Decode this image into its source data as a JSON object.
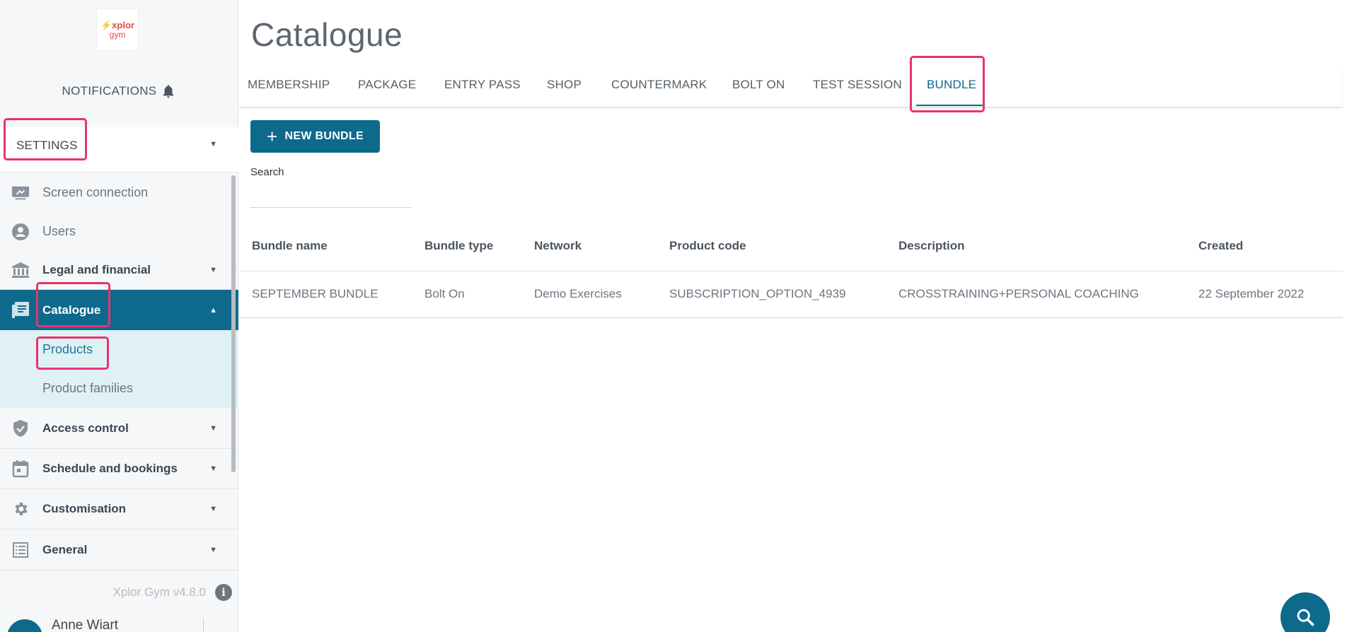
{
  "sidebar": {
    "logo": {
      "line1": "⚡xplor",
      "line2": "gym"
    },
    "notifications_label": "NOTIFICATIONS",
    "settings_label": "SETTINGS",
    "items": [
      {
        "label": "Screen connection",
        "icon": "screen-icon"
      },
      {
        "label": "Users",
        "icon": "user-icon"
      },
      {
        "label": "Legal and financial",
        "icon": "bank-icon"
      },
      {
        "label": "Catalogue",
        "icon": "catalogue-icon"
      },
      {
        "label": "Access control",
        "icon": "shield-icon"
      },
      {
        "label": "Schedule and bookings",
        "icon": "calendar-icon"
      },
      {
        "label": "Customisation",
        "icon": "gear-icon"
      },
      {
        "label": "General",
        "icon": "list-icon"
      }
    ],
    "catalogue_sub": [
      {
        "label": "Products"
      },
      {
        "label": "Product families"
      }
    ],
    "version": "Xplor Gym v4.8.0",
    "user_name": "Anne Wiart",
    "accent_color": "#0d6a8c",
    "highlight_color": "#e8336b"
  },
  "main": {
    "title": "Catalogue",
    "tabs": [
      {
        "label": "MEMBERSHIP"
      },
      {
        "label": "PACKAGE"
      },
      {
        "label": "ENTRY PASS"
      },
      {
        "label": "SHOP"
      },
      {
        "label": "COUNTERMARK"
      },
      {
        "label": "BOLT ON"
      },
      {
        "label": "TEST SESSION"
      },
      {
        "label": "BUNDLE"
      }
    ],
    "active_tab": "BUNDLE",
    "new_button_label": "NEW BUNDLE",
    "search_label": "Search",
    "search_value": "",
    "table": {
      "columns": [
        "Bundle name",
        "Bundle type",
        "Network",
        "Product code",
        "Description",
        "Created"
      ],
      "rows": [
        [
          "SEPTEMBER BUNDLE",
          "Bolt On",
          "Demo Exercises",
          "SUBSCRIPTION_OPTION_4939",
          "CROSSTRAINING+PERSONAL COACHING",
          "22 September 2022"
        ]
      ]
    }
  }
}
